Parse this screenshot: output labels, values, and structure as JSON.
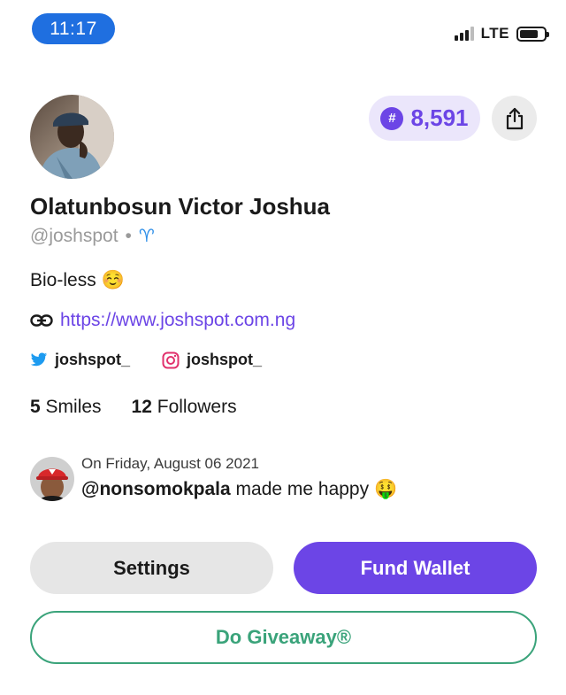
{
  "status_bar": {
    "time": "11:17",
    "network": "LTE",
    "signal_bars_active": 3,
    "signal_bars_total": 4,
    "battery_level": 0.75
  },
  "profile": {
    "coins": "8,591",
    "coin_symbol": "#",
    "name": "Olatunbosun Victor Joshua",
    "handle": "@joshspot",
    "separator": "•",
    "zodiac_symbol": "♈",
    "bio": "Bio-less ☺️",
    "website": "https://www.joshspot.com.ng",
    "twitter": "joshspot_",
    "instagram": "joshspot_",
    "smiles_count": "5",
    "smiles_label": "Smiles",
    "followers_count": "12",
    "followers_label": "Followers"
  },
  "activity": {
    "date": "On Friday, August 06 2021",
    "user": "@nonsomokpala",
    "message": "made me happy 🤑"
  },
  "buttons": {
    "settings": "Settings",
    "fund_wallet": "Fund Wallet",
    "giveaway": "Do Giveaway®"
  },
  "colors": {
    "accent": "#6c45e6",
    "time_pill": "#1f6fe0",
    "giveaway": "#3aa37a",
    "twitter": "#1d9bf0",
    "instagram": "#e1306c"
  },
  "icons": {
    "share": "share-icon",
    "link": "link-icon",
    "twitter": "twitter-icon",
    "instagram": "instagram-icon",
    "coin": "coin-icon"
  }
}
